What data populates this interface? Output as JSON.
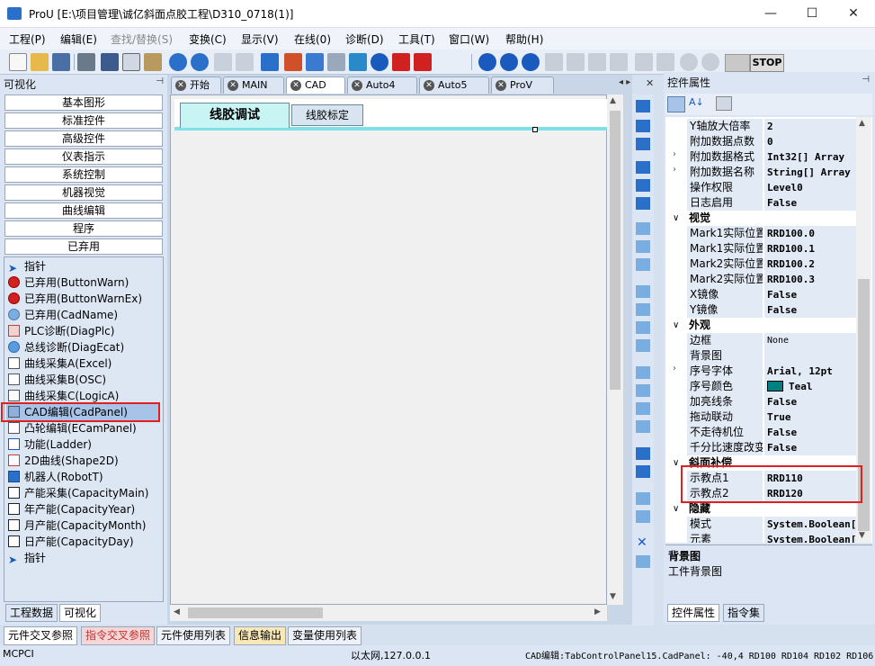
{
  "window": {
    "title": "ProU [E:\\项目管理\\诚亿斜面点胶工程\\D310_0718(1)]",
    "minimize": "—",
    "maximize": "☐",
    "close": "✕"
  },
  "menu": [
    "工程(P)",
    "编辑(E)",
    "查找/替换(S)",
    "变换(C)",
    "显示(V)",
    "在线(0)",
    "诊断(D)",
    "工具(T)",
    "窗口(W)",
    "帮助(H)"
  ],
  "toolbar": {
    "stop_label": "STOP"
  },
  "left_panel": {
    "title": "可视化",
    "pin": "⊣",
    "categories": [
      "基本图形",
      "标准控件",
      "高级控件",
      "仪表指示",
      "系统控制",
      "机器视觉",
      "曲线编辑",
      "程序",
      "已弃用"
    ],
    "tools": [
      {
        "label": "指针",
        "icon": "pointer-icon"
      },
      {
        "label": "已弃用(ButtonWarn)",
        "icon": "warning-icon"
      },
      {
        "label": "已弃用(ButtonWarnEx)",
        "icon": "warning-icon"
      },
      {
        "label": "已弃用(CadName)",
        "icon": "cad-name-icon"
      },
      {
        "label": "PLC诊断(DiagPlc)",
        "icon": "plc-diag-icon"
      },
      {
        "label": "总线诊断(DiagEcat)",
        "icon": "bus-diag-icon"
      },
      {
        "label": "曲线采集A(Excel)",
        "icon": "curve-icon"
      },
      {
        "label": "曲线采集B(OSC)",
        "icon": "curve-icon"
      },
      {
        "label": "曲线采集C(LogicA)",
        "icon": "curve-icon"
      },
      {
        "label": "CAD编辑(CadPanel)",
        "icon": "cad-panel-icon"
      },
      {
        "label": "凸轮编辑(ECamPanel)",
        "icon": "cam-icon"
      },
      {
        "label": "功能(Ladder)",
        "icon": "ladder-icon"
      },
      {
        "label": "2D曲线(Shape2D)",
        "icon": "shape2d-icon"
      },
      {
        "label": "机器人(RobotT)",
        "icon": "robot-icon"
      },
      {
        "label": "产能采集(CapacityMain)",
        "icon": "capacity-icon"
      },
      {
        "label": "年产能(CapacityYear)",
        "icon": "capacity-icon"
      },
      {
        "label": "月产能(CapacityMonth)",
        "icon": "capacity-icon"
      },
      {
        "label": "日产能(CapacityDay)",
        "icon": "capacity-icon"
      },
      {
        "label": "指针",
        "icon": "pointer-icon"
      }
    ],
    "bottom_tabs": [
      "工程数据",
      "可视化"
    ]
  },
  "doc_tabs": [
    "开始",
    "MAIN",
    "CAD",
    "Auto4",
    "Auto5",
    "ProV"
  ],
  "canvas": {
    "tab_active": "线胶调试",
    "tab_other": "线胶标定"
  },
  "right_panel": {
    "title": "控件属性",
    "pin": "⊣",
    "rows": [
      {
        "name": "Y轴放大倍率",
        "value": "2"
      },
      {
        "name": "附加数据点数",
        "value": "0"
      },
      {
        "name": "附加数据格式",
        "value": "Int32[] Array",
        "exp": "›"
      },
      {
        "name": "附加数据名称",
        "value": "String[] Array",
        "exp": "›"
      },
      {
        "name": "操作权限",
        "value": "Level0"
      },
      {
        "name": "日志启用",
        "value": "False"
      },
      {
        "cat": "视觉"
      },
      {
        "name": "Mark1实际位置",
        "value": "RRD100.0"
      },
      {
        "name": "Mark1实际位置",
        "value": "RRD100.1"
      },
      {
        "name": "Mark2实际位置",
        "value": "RRD100.2"
      },
      {
        "name": "Mark2实际位置",
        "value": "RRD100.3"
      },
      {
        "name": "X镜像",
        "value": "False"
      },
      {
        "name": "Y镜像",
        "value": "False"
      },
      {
        "cat": "外观"
      },
      {
        "name": "边框",
        "value": "None",
        "plain": true
      },
      {
        "name": "背景图",
        "value": ""
      },
      {
        "name": "序号字体",
        "value": "Arial, 12pt",
        "exp": "›"
      },
      {
        "name": "序号颜色",
        "value": "Teal",
        "swatch": "#008080"
      },
      {
        "name": "加亮线条",
        "value": "False"
      },
      {
        "name": "拖动联动",
        "value": "True"
      },
      {
        "name": "不走待机位",
        "value": "False"
      },
      {
        "name": "千分比速度改变",
        "value": "False"
      },
      {
        "cat": "斜面补偿"
      },
      {
        "name": "示教点1",
        "value": "RRD110"
      },
      {
        "name": "示教点2",
        "value": "RRD120"
      },
      {
        "cat": "隐藏"
      },
      {
        "name": "模式",
        "value": "System.Boolean["
      },
      {
        "name": "元素",
        "value": "System.Boolean["
      }
    ],
    "desc_title": "背景图",
    "desc_text": "工件背景图",
    "bottom_tabs": [
      "控件属性",
      "指令集"
    ]
  },
  "output_tabs": [
    "元件交叉参照",
    "指令交叉参照",
    "元件使用列表",
    "信息输出",
    "变量使用列表"
  ],
  "status": {
    "left": "MCPCI",
    "center": "以太网,127.0.0.1",
    "right": "CAD编辑:TabControlPanel15.CadPanel: -40,4 RD100 RD104 RD102 RD106"
  },
  "colors": {
    "highlight": "#e02020",
    "accent": "#2a6fc9",
    "teal": "#008080"
  }
}
